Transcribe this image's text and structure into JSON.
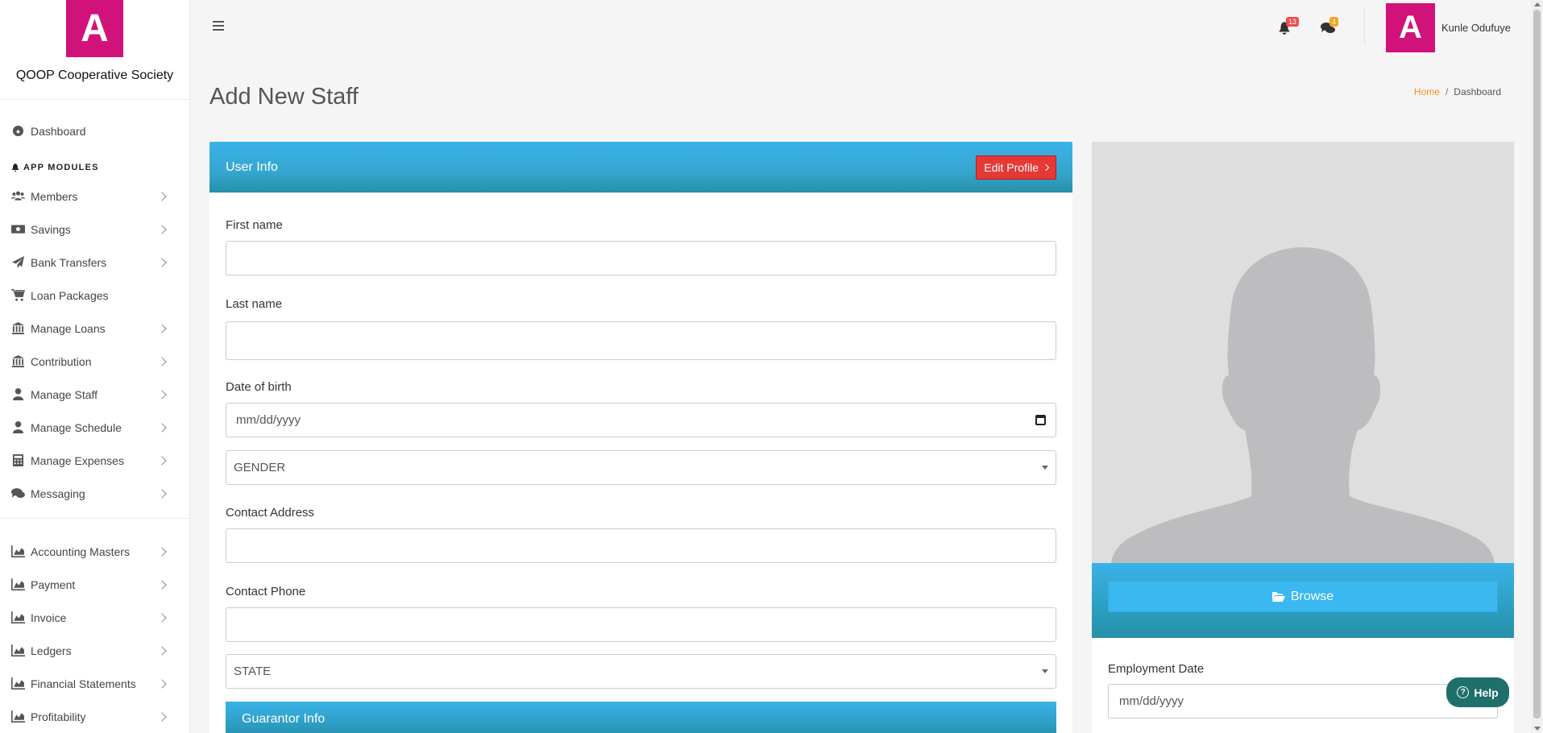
{
  "brand": {
    "logo_letter": "A",
    "name": "QOOP Cooperative Society",
    "color": "#d1127a"
  },
  "sidebar": {
    "dashboard": "Dashboard",
    "section_title": "APP MODULES",
    "modules": [
      {
        "label": "Members",
        "icon": "users-icon"
      },
      {
        "label": "Savings",
        "icon": "money-icon"
      },
      {
        "label": "Bank Transfers",
        "icon": "paper-plane-icon"
      },
      {
        "label": "Loan Packages",
        "icon": "cart-icon"
      },
      {
        "label": "Manage Loans",
        "icon": "bank-icon"
      },
      {
        "label": "Contribution",
        "icon": "bank-icon"
      },
      {
        "label": "Manage Staff",
        "icon": "user-icon"
      },
      {
        "label": "Manage Schedule",
        "icon": "user-icon"
      },
      {
        "label": "Manage Expenses",
        "icon": "calculator-icon"
      },
      {
        "label": "Messaging",
        "icon": "comments-icon"
      }
    ],
    "accounting": [
      {
        "label": "Accounting Masters",
        "icon": "chart-area-icon"
      },
      {
        "label": "Payment",
        "icon": "chart-area-icon"
      },
      {
        "label": "Invoice",
        "icon": "chart-area-icon"
      },
      {
        "label": "Ledgers",
        "icon": "chart-area-icon"
      },
      {
        "label": "Financial Statements",
        "icon": "chart-area-icon"
      },
      {
        "label": "Profitability",
        "icon": "chart-area-icon"
      }
    ]
  },
  "topbar": {
    "notifications_count": "13",
    "messages_count": "4",
    "user_avatar_letter": "A",
    "user_name": "Kunle Odufuye"
  },
  "page": {
    "title": "Add New Staff",
    "breadcrumb_home": "Home",
    "breadcrumb_current": "Dashboard"
  },
  "user_info": {
    "title": "User Info",
    "edit_profile": "Edit Profile",
    "first_name_label": "First name",
    "last_name_label": "Last name",
    "dob_label": "Date of birth",
    "dob_placeholder": "mm/dd/yyyy",
    "gender_value": "GENDER",
    "address_label": "Contact Address",
    "phone_label": "Contact Phone",
    "state_value": "STATE",
    "guarantor_title": "Guarantor Info"
  },
  "photo_panel": {
    "browse_label": "Browse",
    "employment_date_label": "Employment Date",
    "employment_date_placeholder": "mm/dd/yyyy"
  },
  "help_label": "Help",
  "colors": {
    "accent": "#35a6cf",
    "danger": "#e53935",
    "help": "#1f6f6a",
    "link": "#f7931e"
  }
}
